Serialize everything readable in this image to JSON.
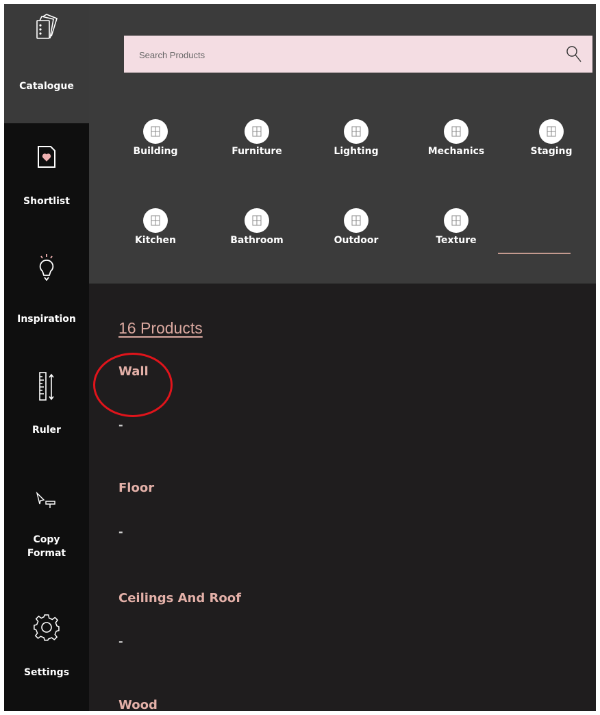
{
  "sidebar": {
    "items": [
      {
        "id": "catalogue",
        "label": "Catalogue",
        "icon": "catalogue-icon",
        "active": true
      },
      {
        "id": "shortlist",
        "label": "Shortlist",
        "icon": "heart-document-icon"
      },
      {
        "id": "inspiration",
        "label": "Inspiration",
        "icon": "lightbulb-icon"
      },
      {
        "id": "ruler",
        "label": "Ruler",
        "icon": "ruler-icon"
      },
      {
        "id": "copy-format",
        "label_line1": "Copy",
        "label_line2": "Format",
        "icon": "paint-cursor-icon"
      },
      {
        "id": "settings",
        "label": "Settings",
        "icon": "gear-icon"
      }
    ]
  },
  "search": {
    "placeholder": "Search Products",
    "value": ""
  },
  "categories": [
    {
      "label": "Building"
    },
    {
      "label": "Furniture"
    },
    {
      "label": "Lighting"
    },
    {
      "label": "Mechanics"
    },
    {
      "label": "Staging"
    },
    {
      "label": "Kitchen"
    },
    {
      "label": "Bathroom"
    },
    {
      "label": "Outdoor"
    },
    {
      "label": "Texture",
      "selected": true
    }
  ],
  "content": {
    "count_label": "16 Products",
    "sections": [
      {
        "title": "Wall",
        "value": "-"
      },
      {
        "title": "Floor",
        "value": "-"
      },
      {
        "title": "Ceilings And Roof",
        "value": "-"
      },
      {
        "title": "Wood"
      }
    ]
  },
  "colors": {
    "accent": "#dba9a0",
    "search_bg": "#f4dde3",
    "highlight": "#e0141b",
    "sidebar_bg": "#0f0f0f",
    "panel_bg": "#3b3b3b"
  }
}
